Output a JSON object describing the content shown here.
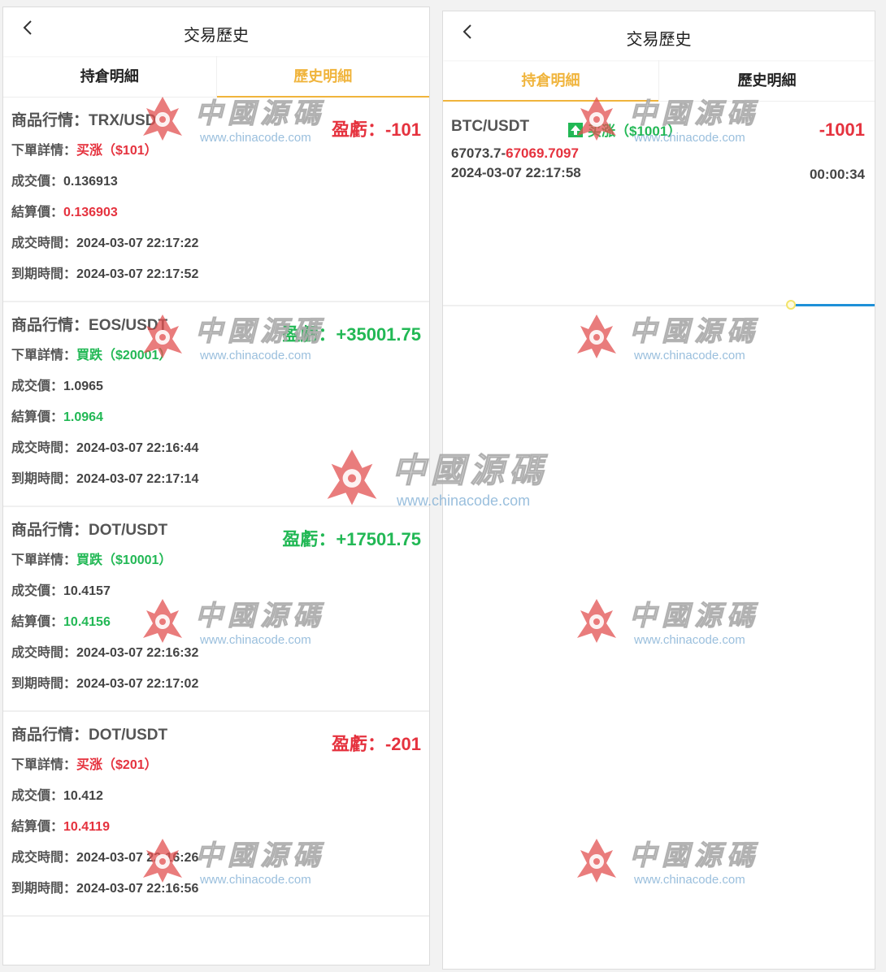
{
  "left": {
    "title": "交易歷史",
    "tabs": [
      "持倉明細",
      "歷史明細"
    ],
    "labels": {
      "market": "商品行情：",
      "order": "下單詳情：",
      "deal_price": "成交價：",
      "settle_price": "結算價：",
      "deal_time": "成交時間：",
      "expire_time": "到期時間：",
      "profit": "盈虧："
    },
    "records": [
      {
        "symbol": "TRX/USDT",
        "profit": "-101",
        "order": "买涨（$101）",
        "deal_price": "0.136913",
        "settle_price": "0.136903",
        "deal_time": "2024-03-07 22:17:22",
        "expire_time": "2024-03-07 22:17:52",
        "color": "#e5323e"
      },
      {
        "symbol": "EOS/USDT",
        "profit": "+35001.75",
        "order": "買跌（$20001）",
        "deal_price": "1.0965",
        "settle_price": "1.0964",
        "deal_time": "2024-03-07 22:16:44",
        "expire_time": "2024-03-07 22:17:14",
        "color": "#22b855"
      },
      {
        "symbol": "DOT/USDT",
        "profit": "+17501.75",
        "order": "買跌（$10001）",
        "deal_price": "10.4157",
        "settle_price": "10.4156",
        "deal_time": "2024-03-07 22:16:32",
        "expire_time": "2024-03-07 22:17:02",
        "color": "#22b855"
      },
      {
        "symbol": "DOT/USDT",
        "profit": "-201",
        "order": "买涨（$201）",
        "deal_price": "10.412",
        "settle_price": "10.4119",
        "deal_time": "2024-03-07 22:16:26",
        "expire_time": "2024-03-07 22:16:56",
        "color": "#e5323e"
      }
    ]
  },
  "right": {
    "title": "交易歷史",
    "tabs": [
      "持倉明細",
      "歷史明細"
    ],
    "position": {
      "symbol": "BTC/USDT",
      "direction": "买涨（$1001）",
      "pl": "-1001",
      "open_price": "67073.7-",
      "current_price": "67069.7097",
      "time": "2024-03-07 22:17:58",
      "countdown": "00:00:34",
      "progress": 0.19
    }
  },
  "watermark": {
    "cn": "中國源碼",
    "url": "www.chinacode.com"
  },
  "colors": {
    "accent": "#f0b43c",
    "up": "#e5323e",
    "down": "#22b855",
    "progress": "#1e90d8"
  }
}
